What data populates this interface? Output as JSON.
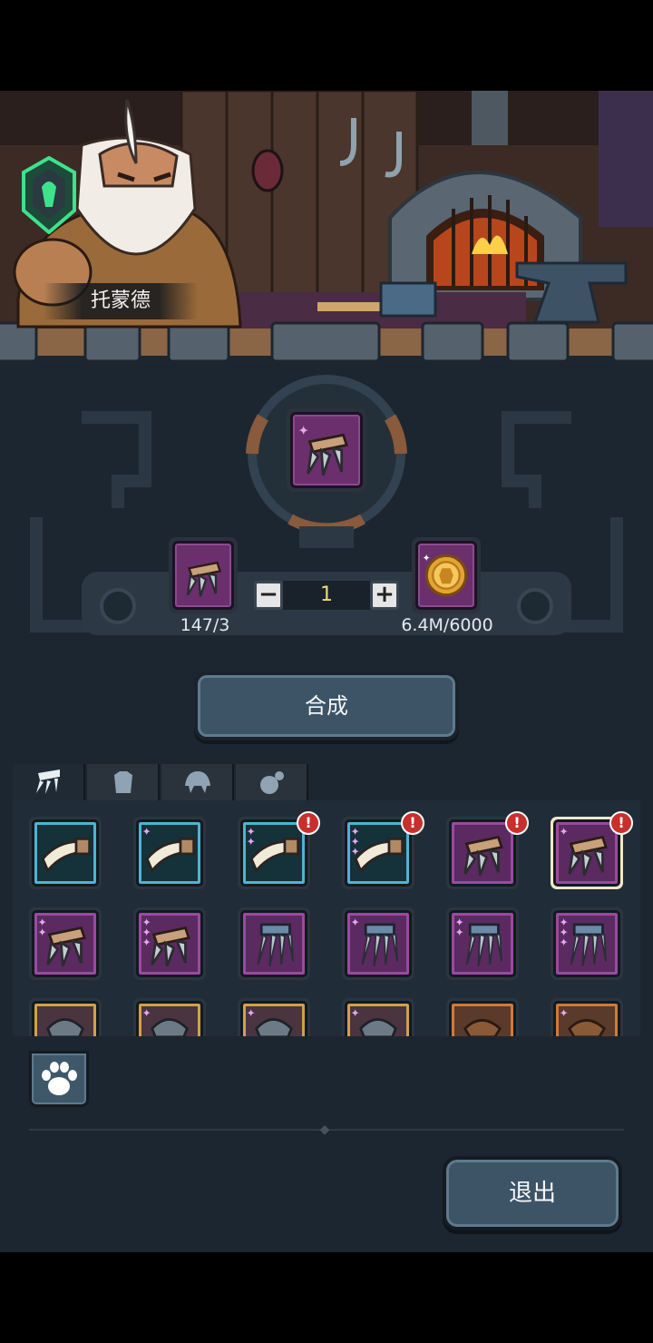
{
  "npc": {
    "name": "托蒙德"
  },
  "craft": {
    "material_count": "147/3",
    "quantity": "1",
    "minus_label": "−",
    "plus_label": "+",
    "gold_count": "6.4M/6000",
    "craft_button": "合成"
  },
  "tabs": [
    {
      "icon": "claw-weapon-icon"
    },
    {
      "icon": "armor-icon"
    },
    {
      "icon": "helmet-icon"
    },
    {
      "icon": "accessory-icon"
    }
  ],
  "inventory": {
    "rows": [
      [
        "blue",
        "blue",
        "blue",
        "blue",
        "purple",
        "purple"
      ],
      [
        "purple",
        "purple",
        "purple",
        "purple",
        "purple",
        "purple"
      ],
      [
        "gold",
        "gold",
        "gold",
        "gold",
        "orange",
        "orange"
      ]
    ],
    "alerts_label": "!"
  },
  "footer": {
    "exit_button": "退出",
    "paw_icon": "paw-icon"
  },
  "colors": {
    "panel": "#1c2630",
    "button": "#3c5466",
    "quantity": "#f2d77a",
    "alert": "#c8302c"
  }
}
